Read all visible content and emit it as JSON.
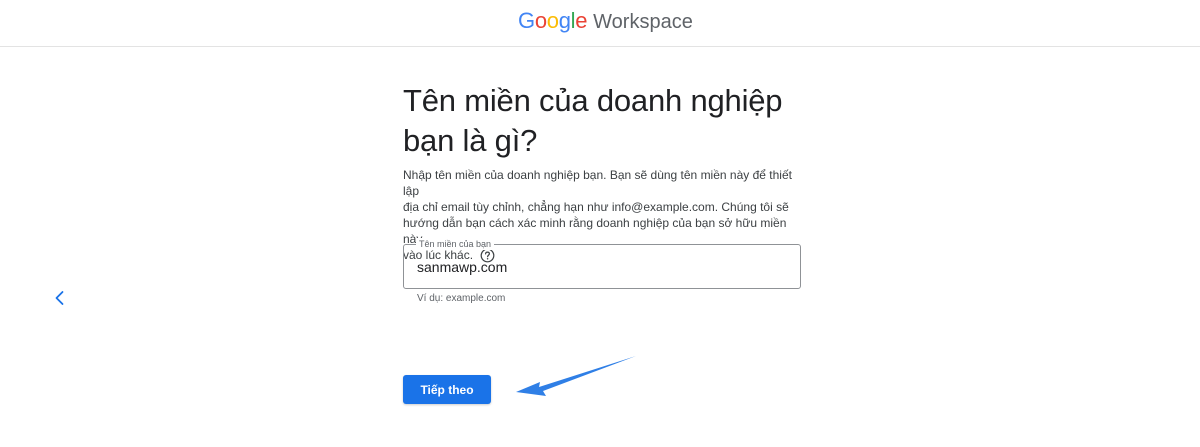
{
  "header": {
    "logo_google_letters": [
      "G",
      "o",
      "o",
      "g",
      "l",
      "e"
    ],
    "logo_google_colors": [
      "#4285f4",
      "#ea4335",
      "#fbbc05",
      "#4285f4",
      "#34a853",
      "#ea4335"
    ],
    "logo_product": "Workspace"
  },
  "nav": {
    "back_icon": "chevron-left-icon"
  },
  "main": {
    "title_line1": "Tên miền của doanh nghiệp",
    "title_line2": "bạn là gì?",
    "description_lines": [
      "Nhập tên miền của doanh nghiệp bạn. Bạn sẽ dùng tên miền này để thiết lập",
      "địa chỉ email tùy chỉnh, chẳng hạn như info@example.com. Chúng tôi sẽ",
      "hướng dẫn bạn cách xác minh rằng doanh nghiệp của bạn sở hữu miền này",
      "vào lúc khác."
    ],
    "help_icon": "help-circle-icon",
    "domain_field": {
      "label": "Tên miền của bạn",
      "value": "sanmawp.com",
      "hint": "Ví dụ: example.com"
    },
    "next_button": "Tiếp theo"
  },
  "colors": {
    "primary": "#1a73e8",
    "arrow": "#2f7fe6",
    "divider": "#e3e3e3"
  }
}
